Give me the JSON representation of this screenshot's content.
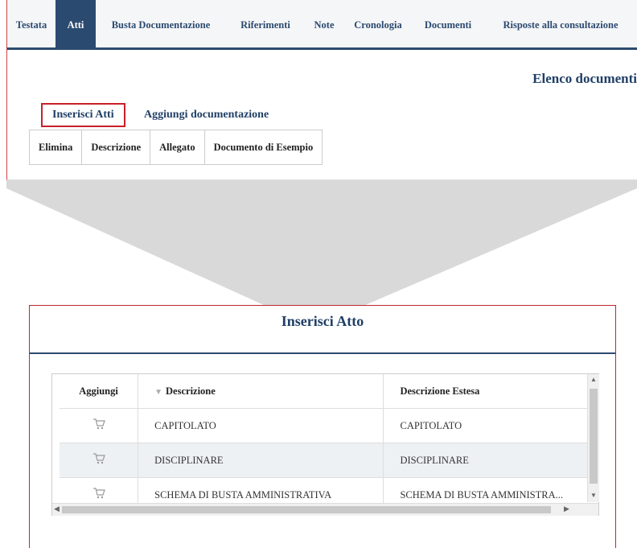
{
  "tabs": [
    {
      "label": "Testata"
    },
    {
      "label": "Atti"
    },
    {
      "label": "Busta Documentazione"
    },
    {
      "label": "Riferimenti"
    },
    {
      "label": "Note"
    },
    {
      "label": "Cronologia"
    },
    {
      "label": "Documenti"
    },
    {
      "label": "Risposte alla consultazione"
    }
  ],
  "active_tab": "Atti",
  "panel": {
    "title": "Elenco documenti",
    "subtabs": {
      "inserisci": "Inserisci Atti",
      "aggiungi": "Aggiungi documentazione"
    },
    "table_headers": [
      "Elimina",
      "Descrizione",
      "Allegato",
      "Documento di Esempio"
    ]
  },
  "modal": {
    "title": "Inserisci Atto",
    "columns": [
      "Aggiungi",
      "Descrizione",
      "Descrizione Estesa"
    ],
    "rows": [
      {
        "icon": "cart-icon",
        "descrizione": "CAPITOLATO",
        "estesa": "CAPITOLATO"
      },
      {
        "icon": "cart-icon",
        "descrizione": "DISCIPLINARE",
        "estesa": "DISCIPLINARE"
      },
      {
        "icon": "cart-icon",
        "descrizione": "SCHEMA DI BUSTA AMMINISTRATIVA",
        "estesa": "SCHEMA DI BUSTA AMMINISTRA..."
      }
    ]
  },
  "colors": {
    "accent": "#2b4a6f",
    "title": "#1f3f66",
    "highlight_border": "#c8202a",
    "funnel": "#d9d9d9"
  }
}
